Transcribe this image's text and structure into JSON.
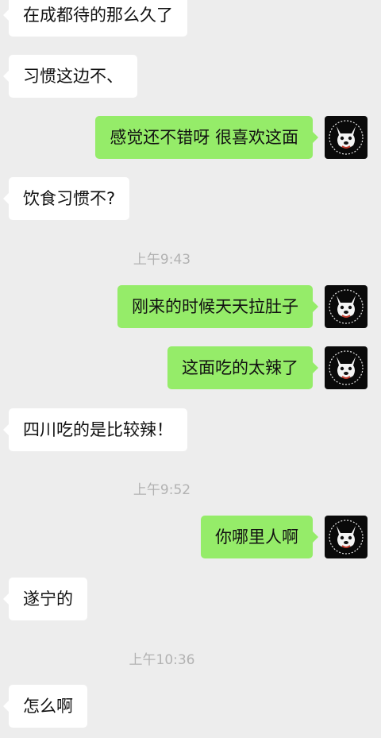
{
  "conversation": {
    "messages": [
      {
        "from": "contact",
        "text": "在成都待的那么久了"
      },
      {
        "from": "contact",
        "text": "习惯这边不、"
      },
      {
        "from": "me",
        "text": "感觉还不错呀 很喜欢这面"
      },
      {
        "from": "contact",
        "text": "饮食习惯不?"
      },
      {
        "from": "me",
        "text": "刚来的时候天天拉肚子"
      },
      {
        "from": "me",
        "text": "这面吃的太辣了"
      },
      {
        "from": "contact",
        "text": "四川吃的是比较辣！"
      },
      {
        "from": "me",
        "text": "你哪里人啊"
      },
      {
        "from": "contact",
        "text": "遂宁的"
      },
      {
        "from": "contact",
        "text": "怎么啊"
      }
    ],
    "timestamps": [
      "上午9:43",
      "上午9:52",
      "上午10:36"
    ]
  },
  "avatar": {
    "icon": "bulldog-avatar-icon",
    "background": "#0a0a0a"
  },
  "colors": {
    "background": "#ededed",
    "incoming_bubble": "#ffffff",
    "outgoing_bubble": "#95ec69",
    "timestamp_text": "#b2b2b2"
  }
}
